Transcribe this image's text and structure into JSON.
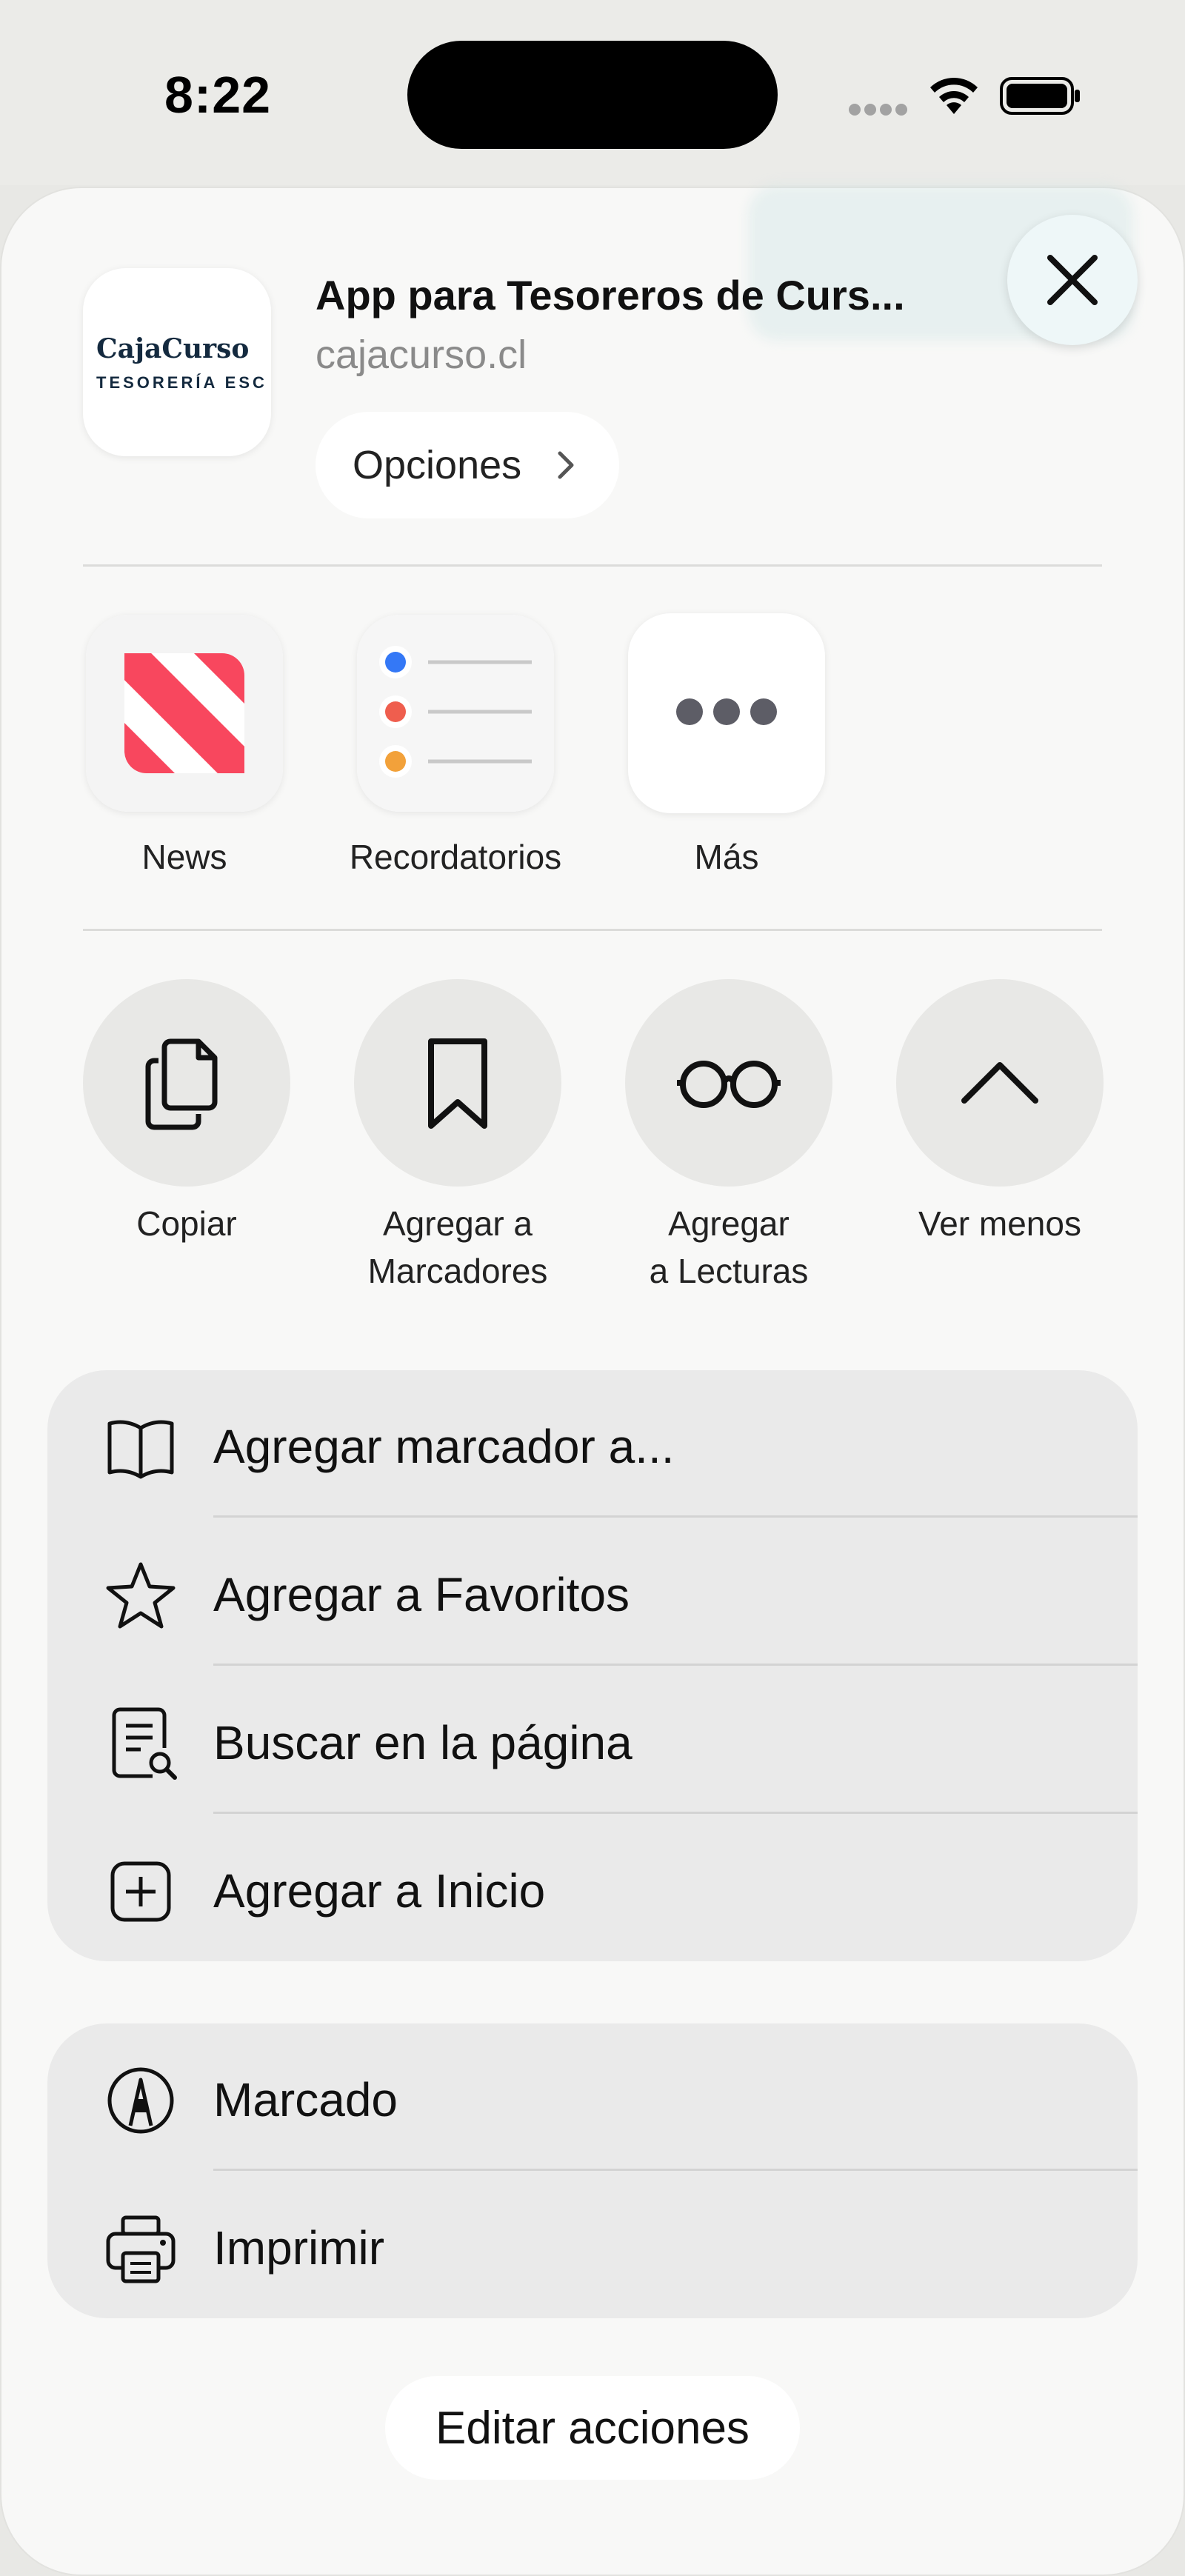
{
  "status_bar": {
    "time": "8:22"
  },
  "share_header": {
    "app_icon_brand": "CajaCurso",
    "app_icon_subtitle": "TESORERÍA ESC",
    "title": "App para Tesoreros de Curs...",
    "url": "cajacurso.cl",
    "options_label": "Opciones"
  },
  "apps": [
    {
      "label": "News",
      "icon": "news-icon"
    },
    {
      "label": "Recordatorios",
      "icon": "reminders-icon"
    },
    {
      "label": "Más",
      "icon": "more-icon"
    }
  ],
  "actions": [
    {
      "label": "Copiar",
      "icon": "copy-icon"
    },
    {
      "label": "Agregar a\nMarcadores",
      "icon": "bookmark-icon"
    },
    {
      "label": "Agregar\na Lecturas",
      "icon": "glasses-icon"
    },
    {
      "label": "Ver menos",
      "icon": "chevron-up-icon"
    }
  ],
  "list1": [
    {
      "label": "Agregar marcador a...",
      "icon": "book-icon"
    },
    {
      "label": "Agregar a Favoritos",
      "icon": "star-icon"
    },
    {
      "label": "Buscar en la página",
      "icon": "find-page-icon"
    },
    {
      "label": "Agregar a Inicio",
      "icon": "add-square-icon"
    }
  ],
  "list2": [
    {
      "label": "Marcado",
      "icon": "markup-icon"
    },
    {
      "label": "Imprimir",
      "icon": "printer-icon"
    }
  ],
  "edit_actions_label": "Editar acciones",
  "colors": {
    "news_red": "#f8475e",
    "sheet_bg": "#f9f9f8",
    "list_bg": "#eaeaea"
  }
}
